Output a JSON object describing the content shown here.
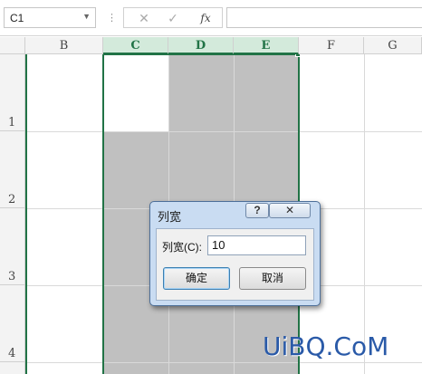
{
  "formula_bar": {
    "name_box": "C1",
    "name_box_arrow": "▼",
    "separator": "⋮",
    "cancel_symbol": "✕",
    "enter_symbol": "✓",
    "fx_symbol": "fx",
    "formula": ""
  },
  "columns": [
    {
      "label": "B",
      "selected": false
    },
    {
      "label": "C",
      "selected": true
    },
    {
      "label": "D",
      "selected": true
    },
    {
      "label": "E",
      "selected": true
    },
    {
      "label": "F",
      "selected": false
    },
    {
      "label": "G",
      "selected": false
    }
  ],
  "rows": [
    "1",
    "2",
    "3",
    "4"
  ],
  "dialog": {
    "title": "列宽",
    "help_label": "?",
    "close_label": "✕",
    "field_label": "列宽(C):",
    "field_value": "10",
    "ok_label": "确定",
    "cancel_label": "取消"
  },
  "watermark": "UiBQ.CoM",
  "colors": {
    "accent": "#217346",
    "selected_header_bg": "#d3eadb",
    "selection_fill": "#c0c0c0"
  }
}
